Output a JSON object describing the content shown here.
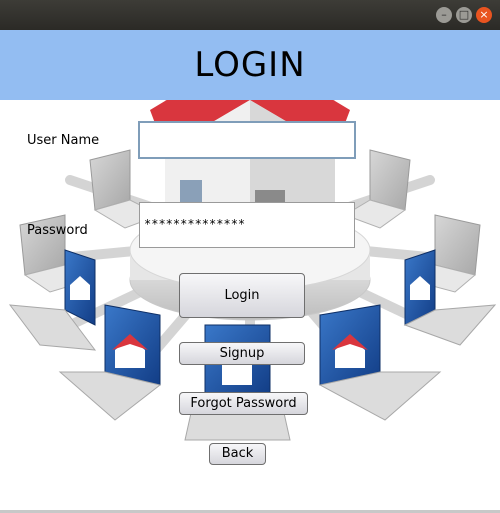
{
  "window": {
    "controls": {
      "minimize_icon": "–",
      "maximize_icon": "□",
      "close_icon": "×"
    }
  },
  "header": {
    "title": "LOGIN",
    "background": "#93bdf2"
  },
  "form": {
    "username_label": "User Name",
    "username_value": "",
    "password_label": "Password",
    "password_value": "**************"
  },
  "buttons": {
    "login": "Login",
    "signup": "Signup",
    "forgot_password": "Forgot Password",
    "back": "Back"
  },
  "colors": {
    "accent_close": "#e95420",
    "roof": "#d9363e",
    "screen": "#1f57a8"
  }
}
